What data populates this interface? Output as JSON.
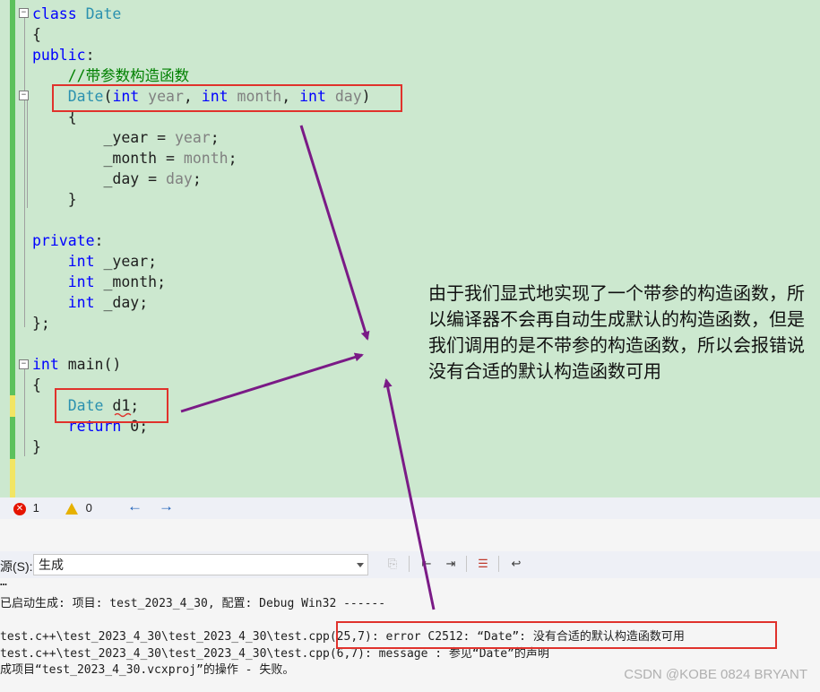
{
  "editor": {
    "lines": [
      {
        "id": "l1",
        "parts": [
          [
            "kw",
            "class"
          ],
          [
            "",
            ""
          ],
          [
            "ty",
            " Date"
          ]
        ]
      },
      {
        "id": "l2",
        "parts": [
          [
            "",
            "{"
          ]
        ]
      },
      {
        "id": "l3",
        "parts": [
          [
            "kw",
            "public"
          ],
          [
            "",
            ":"
          ]
        ]
      },
      {
        "id": "l4",
        "parts": [
          [
            "",
            "    "
          ],
          [
            "cm",
            "//带参数构造函数"
          ]
        ]
      },
      {
        "id": "l5",
        "parts": [
          [
            "",
            "    "
          ],
          [
            "ty",
            "Date"
          ],
          [
            "",
            "("
          ],
          [
            "kw",
            "int"
          ],
          [
            "pm",
            " year"
          ],
          [
            "",
            ", "
          ],
          [
            "kw",
            "int"
          ],
          [
            "pm",
            " month"
          ],
          [
            "",
            ", "
          ],
          [
            "kw",
            "int"
          ],
          [
            "pm",
            " day"
          ],
          [
            "",
            ")"
          ]
        ]
      },
      {
        "id": "l6",
        "parts": [
          [
            "",
            "    {"
          ]
        ]
      },
      {
        "id": "l7",
        "parts": [
          [
            "",
            "        _year = "
          ],
          [
            "pm",
            "year"
          ],
          [
            "",
            ";"
          ]
        ]
      },
      {
        "id": "l8",
        "parts": [
          [
            "",
            "        _month = "
          ],
          [
            "pm",
            "month"
          ],
          [
            "",
            ";"
          ]
        ]
      },
      {
        "id": "l9",
        "parts": [
          [
            "",
            "        _day = "
          ],
          [
            "pm",
            "day"
          ],
          [
            "",
            ";"
          ]
        ]
      },
      {
        "id": "l10",
        "parts": [
          [
            "",
            "    }"
          ]
        ]
      },
      {
        "id": "l11",
        "parts": [
          [
            "",
            ""
          ]
        ]
      },
      {
        "id": "l12",
        "parts": [
          [
            "kw",
            "private"
          ],
          [
            "",
            ":"
          ]
        ]
      },
      {
        "id": "l13",
        "parts": [
          [
            "",
            "    "
          ],
          [
            "kw",
            "int"
          ],
          [
            "",
            " _year;"
          ]
        ]
      },
      {
        "id": "l14",
        "parts": [
          [
            "",
            "    "
          ],
          [
            "kw",
            "int"
          ],
          [
            "",
            " _month;"
          ]
        ]
      },
      {
        "id": "l15",
        "parts": [
          [
            "",
            "    "
          ],
          [
            "kw",
            "int"
          ],
          [
            "",
            " _day;"
          ]
        ]
      },
      {
        "id": "l16",
        "parts": [
          [
            "",
            "};"
          ]
        ]
      },
      {
        "id": "l17",
        "parts": [
          [
            "",
            ""
          ]
        ]
      },
      {
        "id": "l18",
        "parts": [
          [
            "kw",
            "int"
          ],
          [
            "",
            " main()"
          ]
        ]
      },
      {
        "id": "l19",
        "parts": [
          [
            "",
            "{"
          ]
        ]
      },
      {
        "id": "l20",
        "parts": [
          [
            "",
            "    "
          ],
          [
            "ty",
            "Date"
          ],
          [
            "",
            " d1;"
          ]
        ]
      },
      {
        "id": "l21",
        "parts": [
          [
            "",
            "    "
          ],
          [
            "kw",
            "return"
          ],
          [
            "",
            " 0;"
          ]
        ]
      },
      {
        "id": "l22",
        "parts": [
          [
            "",
            "}"
          ]
        ]
      }
    ]
  },
  "annotation": {
    "text": "由于我们显式地实现了一个带参的构造函数，所以编译器不会再自动生成默认的构造函数，但是我们调用的是不带参的构造函数，所以会报错说没有合适的默认构造函数可用"
  },
  "status_bar": {
    "error_count": "1",
    "warning_count": "0",
    "back_label": "←",
    "forward_label": "→"
  },
  "output_panel": {
    "source_label": "源(S):",
    "source_value": "生成",
    "lines": [
      "…",
      "已启动生成: 项目: test_2023_4_30, 配置: Debug Win32 ------",
      "",
      "test.c++\\test_2023_4_30\\test_2023_4_30\\test.cpp(25,7): error C2512: “Date”: 没有合适的默认构造函数可用",
      "test.c++\\test_2023_4_30\\test_2023_4_30\\test.cpp(6,7): message : 参见“Date”的声明",
      "成项目“test_2023_4_30.vcxproj”的操作 - 失败。"
    ]
  },
  "watermark": "CSDN @KOBE 0824 BRYANT",
  "colors": {
    "editor_bg": "#cce8cf",
    "keyword": "#0000ff",
    "type": "#2b91af",
    "param": "#808080",
    "comment": "#008000",
    "highlight_box": "#e0322c",
    "arrow": "#7a1a86"
  }
}
